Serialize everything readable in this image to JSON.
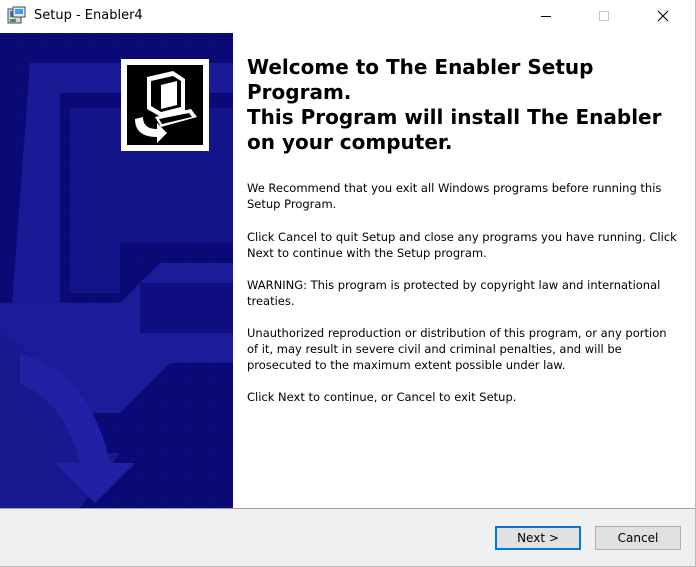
{
  "window": {
    "title": "Setup - Enabler4"
  },
  "icons": {
    "app": "setup-app-icon",
    "minimize": "minimize-icon",
    "maximize": "maximize-icon",
    "close": "close-icon",
    "banner_logo": "computer-install-logo"
  },
  "colors": {
    "banner_background": "#0a0a78",
    "banner_shape": "#1c1c9a",
    "button_focus_border": "#0078d7",
    "footer_background": "#f0f0f0"
  },
  "content": {
    "heading_line1": "Welcome to The Enabler Setup",
    "heading_line2": "Program.",
    "heading_line3": "This Program will install The Enabler",
    "heading_line4": "on your computer.",
    "paragraph1": "We Recommend that you exit all Windows programs before running this Setup Program.",
    "paragraph2": "Click Cancel to quit Setup and close any programs you have running. Click Next to continue with the Setup program.",
    "paragraph3": "WARNING: This program is protected by copyright law and international treaties.",
    "paragraph4": "Unauthorized reproduction or distribution of this program, or any portion of it, may result in severe civil and criminal penalties, and will be prosecuted to the maximum extent possible under law.",
    "paragraph5": "Click Next to continue, or Cancel to exit Setup."
  },
  "buttons": {
    "next_label": "Next >",
    "cancel_label": "Cancel"
  }
}
